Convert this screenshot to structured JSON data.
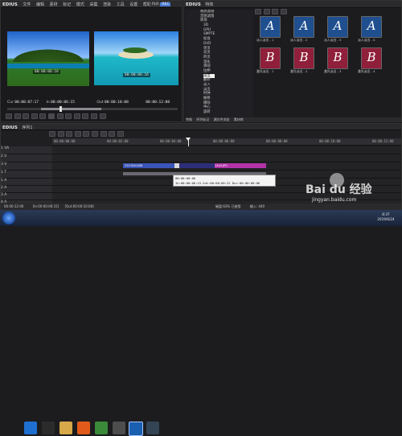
{
  "colors": {
    "accent": "#4a7bd1",
    "clip_blue": "#3a54b8",
    "clip_purple": "#b233a8",
    "title_thumb": "#1f4f8f",
    "bumper_thumb": "#8f1f3a"
  },
  "player": {
    "app": "EDIUS",
    "menu": [
      "文件",
      "编辑",
      "素材",
      "标记",
      "模式",
      "采集",
      "渲染",
      "工具",
      "设置",
      "帮助"
    ],
    "plr": "PLR",
    "rec": "REC",
    "in": "In",
    "out": "Out",
    "cur": "Cur",
    "tc_cur": "00:00:07:17",
    "tc_in": "00:00:06:15",
    "tc_out": "00:00:10:08",
    "tc_dur": "00:00:12:00",
    "preview_tc_left": "00:00:06:16",
    "preview_tc_right": "00:00:06:16",
    "set_label": "Set"
  },
  "effects": {
    "title": "EDIUS",
    "header": "特效",
    "tree": [
      "视频滤镜",
      "音频滤镜",
      "转场",
      "3D",
      "GPU",
      "SMPTE",
      "标准",
      "DVD",
      "单页",
      "双页",
      "四页",
      "溶化",
      "滑动",
      "拉伸",
      "翻转",
      "淡入",
      "淡出",
      "时钟",
      "推移",
      "擦除",
      "中心",
      "旋转",
      "划像",
      "边缘",
      "2D",
      "3D",
      "色键",
      "Alpha"
    ],
    "tree_selected": "淡出",
    "thumbs": [
      {
        "letter": "A",
        "label": "淡入淡出 - 1"
      },
      {
        "letter": "A",
        "label": "淡入淡出 - 2"
      },
      {
        "letter": "A",
        "label": "淡入淡出 - 3"
      },
      {
        "letter": "A",
        "label": "淡入淡出 - 4"
      },
      {
        "letter": "B",
        "label": "激光淡出 - 1"
      },
      {
        "letter": "B",
        "label": "激光淡出 - 2"
      },
      {
        "letter": "B",
        "label": "激光淡出 - 3"
      },
      {
        "letter": "B",
        "label": "激光淡出 - 4"
      }
    ],
    "bottom_tabs": [
      "特效",
      "序列标记",
      "源文件浏览",
      "素材库"
    ]
  },
  "timeline": {
    "app": "EDIUS",
    "seq": "序列1",
    "ruler": [
      "00:00:00:00",
      "00:00:01:00",
      "00:00:02:00",
      "00:00:03:00",
      "00:00:04:00",
      "00:00:05:00",
      "00:00:06:00",
      "00:00:07:00",
      "00:00:08:00",
      "00:00:09:00",
      "00:00:10:00",
      "00:00:11:00",
      "00:00:12:00"
    ],
    "tracks": [
      {
        "name": "1 VA",
        "type": "VA"
      },
      {
        "name": "2 V",
        "type": "V"
      },
      {
        "name": "3 V",
        "type": "V"
      },
      {
        "name": "1 T",
        "type": "T"
      },
      {
        "name": "1 A",
        "type": "A"
      },
      {
        "name": "2 A",
        "type": "A"
      },
      {
        "name": "3 A",
        "type": "A"
      },
      {
        "name": "4 A",
        "type": "A"
      }
    ],
    "clip1": "2013040408",
    "clip2": "1444.JPG",
    "tooltip_line1": "00:00:00:06",
    "tooltip_line2": "In:00:00:06:15 Out:00:00:06:22 Dur:00:00:00:06"
  },
  "status": {
    "left": "00:00:12:00",
    "mid1": "[In:00:00:06:15]",
    "mid2": "[Out:00:00:10:08]",
    "disk": "磁盘:63% 已使用",
    "input": "输入: 440",
    "time": "8:37",
    "date": "2019/6/24"
  },
  "watermark": {
    "brand": "Bai du 经验",
    "url": "jingyan.baidu.com"
  }
}
